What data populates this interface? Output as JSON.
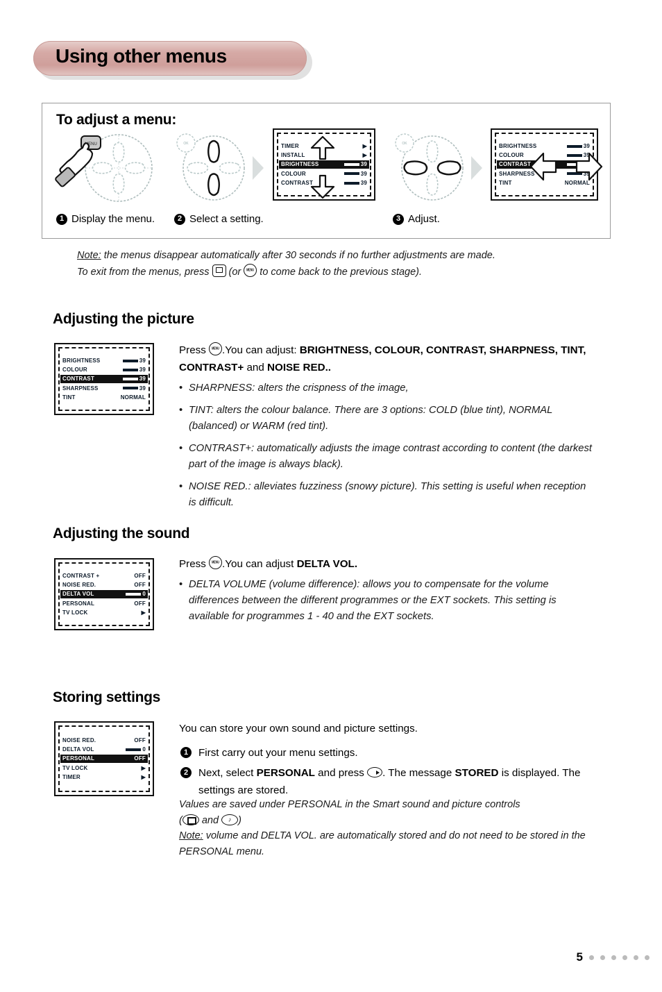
{
  "page": {
    "title": "Using other menus",
    "number": "5",
    "footer_dots": 6
  },
  "adjust_box": {
    "title": "To adjust a menu:",
    "steps": [
      {
        "num": "1",
        "label": "Display the menu."
      },
      {
        "num": "2",
        "label": "Select a setting."
      },
      {
        "num": "3",
        "label": "Adjust."
      }
    ],
    "osd_step2": {
      "rows": [
        {
          "label": "TIMER",
          "value": "▶",
          "highlight": false
        },
        {
          "label": "INSTALL",
          "value": "▶",
          "highlight": false
        },
        {
          "label": "BRIGHTNESS",
          "value": "39",
          "highlight": true
        },
        {
          "label": "COLOUR",
          "value": "39",
          "highlight": false
        },
        {
          "label": "CONTRAST",
          "value": "39",
          "highlight": false
        }
      ]
    },
    "osd_step3": {
      "rows": [
        {
          "label": "BRIGHTNESS",
          "value": "39",
          "highlight": false
        },
        {
          "label": "COLOUR",
          "value": "39",
          "highlight": false
        },
        {
          "label": "CONTRAST",
          "value": "42",
          "highlight": true
        },
        {
          "label": "SHARPNESS",
          "value": "39",
          "highlight": false
        },
        {
          "label": "TINT",
          "value": "NORMAL",
          "highlight": false
        }
      ]
    },
    "remote_button_labels": {
      "menu": "MENU",
      "ok": "OK"
    }
  },
  "note_top": {
    "label": "Note:",
    "line1": " the menus disappear automatically after 30 seconds if no further adjustments are made.",
    "line2_a": "To exit from the menus, press ",
    "line2_b": " (or ",
    "line2_c": " to come back to the previous stage)."
  },
  "picture": {
    "heading": "Adjusting the picture",
    "lead_a": "Press ",
    "lead_b": ".You can adjust: ",
    "lead_bold1": "BRIGHTNESS, COLOUR, CONTRAST, SHARPNESS, TINT, CONTRAST+",
    "lead_mid": " and ",
    "lead_bold2": "NOISE RED..",
    "bullets": [
      "SHARPNESS: alters the crispness of the image,",
      "TINT: alters the colour balance. There are 3 options: COLD (blue tint), NORMAL (balanced) or WARM (red tint).",
      "CONTRAST+: automatically adjusts the image contrast according to content (the darkest part of the image is always black).",
      "NOISE RED.: alleviates fuzziness (snowy picture). This setting is useful when reception is difficult."
    ],
    "osd": {
      "rows": [
        {
          "label": "BRIGHTNESS",
          "value": "39",
          "highlight": false
        },
        {
          "label": "COLOUR",
          "value": "39",
          "highlight": false
        },
        {
          "label": "CONTRAST",
          "value": "39",
          "highlight": true
        },
        {
          "label": "SHARPNESS",
          "value": "39",
          "highlight": false
        },
        {
          "label": "TINT",
          "value": "NORMAL",
          "highlight": false
        }
      ]
    }
  },
  "sound": {
    "heading": "Adjusting the sound",
    "lead_a": "Press ",
    "lead_b": ".You can adjust ",
    "lead_bold": "DELTA VOL.",
    "bullets": [
      "DELTA VOLUME (volume difference): allows you to compensate for the volume differences between the different programmes or the EXT sockets. This setting is available for programmes 1 - 40 and the EXT sockets."
    ],
    "osd": {
      "rows": [
        {
          "label": "CONTRAST +",
          "value": "OFF",
          "highlight": false
        },
        {
          "label": "NOISE RED.",
          "value": "OFF",
          "highlight": false
        },
        {
          "label": "DELTA VOL",
          "value": "0",
          "highlight": true
        },
        {
          "label": "PERSONAL",
          "value": "OFF",
          "highlight": false
        },
        {
          "label": "TV LOCK",
          "value": "▶",
          "highlight": false
        }
      ]
    }
  },
  "storing": {
    "heading": "Storing settings",
    "intro": "You can store your own sound and picture settings.",
    "steps": [
      {
        "num": "1",
        "text": "First carry out your menu settings."
      }
    ],
    "step2": {
      "num": "2",
      "a": "Next, select ",
      "bold1": "PERSONAL",
      "b": " and press ",
      "c": ". The message ",
      "bold2": "STORED",
      "d": " is displayed. The settings are stored."
    },
    "tail_a": "Values are saved under PERSONAL in the Smart sound and picture controls",
    "tail_b_open": "(",
    "tail_b_and": " and ",
    "tail_b_close": ")",
    "note_label": "Note:",
    "note_text": " volume and DELTA VOL. are automatically stored and do not need to be stored in the PERSONAL menu.",
    "osd": {
      "rows": [
        {
          "label": "NOISE RED.",
          "value": "OFF",
          "highlight": false
        },
        {
          "label": "DELTA VOL",
          "value": "0",
          "highlight": false
        },
        {
          "label": "PERSONAL",
          "value": "OFF",
          "highlight": true
        },
        {
          "label": "TV LOCK",
          "value": "▶",
          "highlight": false
        },
        {
          "label": "TIMER",
          "value": "▶",
          "highlight": false
        }
      ]
    }
  },
  "colors": {
    "banner": "#d4a9a5",
    "banner_light": "#e7cfcc",
    "text": "#000000",
    "dots": "#bbbbbb"
  }
}
